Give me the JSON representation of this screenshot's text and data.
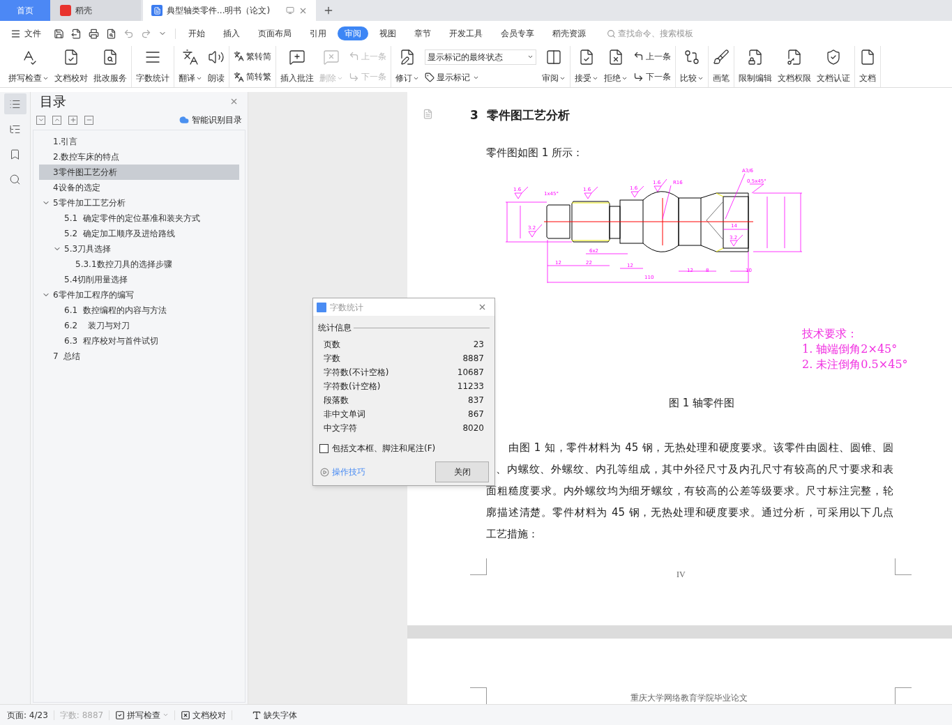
{
  "tab_bar": {
    "tabs": [
      {
        "label": "首页",
        "kind": "home",
        "selected": false
      },
      {
        "label": "稻壳",
        "kind": "docer",
        "selected": false
      },
      {
        "label": "典型轴类零件...明书（论文)",
        "kind": "document",
        "selected": true
      }
    ]
  },
  "menu": {
    "file": "文件",
    "tabs": [
      {
        "label": "开始",
        "selected": false
      },
      {
        "label": "插入",
        "selected": false
      },
      {
        "label": "页面布局",
        "selected": false
      },
      {
        "label": "引用",
        "selected": false
      },
      {
        "label": "审阅",
        "selected": true
      },
      {
        "label": "视图",
        "selected": false
      },
      {
        "label": "章节",
        "selected": false
      },
      {
        "label": "开发工具",
        "selected": false
      },
      {
        "label": "会员专享",
        "selected": false
      },
      {
        "label": "稻壳资源",
        "selected": false
      }
    ],
    "search": {
      "placeholder": "查找命令、搜索模板"
    }
  },
  "ribbon": {
    "groups": [
      {
        "items": [
          {
            "kind": "big",
            "label": "拼写检查",
            "dropdown": true,
            "disabled": false
          },
          {
            "kind": "big",
            "label": "文档校对",
            "dropdown": false,
            "disabled": false
          },
          {
            "kind": "big",
            "label": "批改服务",
            "dropdown": false,
            "disabled": false
          }
        ]
      },
      {
        "items": [
          {
            "kind": "big",
            "label": "字数统计",
            "dropdown": false,
            "disabled": false
          }
        ]
      },
      {
        "items": [
          {
            "kind": "big",
            "label": "翻译",
            "dropdown": true,
            "disabled": false
          },
          {
            "kind": "big",
            "label": "朗读",
            "dropdown": false,
            "disabled": false
          }
        ]
      },
      {
        "items": [
          {
            "kind": "pair",
            "rows": [
              {
                "label": "繁转简",
                "disabled": false
              },
              {
                "label": "简转繁",
                "disabled": false
              }
            ]
          }
        ]
      },
      {
        "items": [
          {
            "kind": "big",
            "label": "插入批注",
            "dropdown": false,
            "disabled": false
          },
          {
            "kind": "big",
            "label": "删除",
            "dropdown": true,
            "disabled": true
          },
          {
            "kind": "pair",
            "rows": [
              {
                "label": "上一条",
                "disabled": true
              },
              {
                "label": "下一条",
                "disabled": true
              }
            ]
          }
        ]
      },
      {
        "items": [
          {
            "kind": "big",
            "label": "修订",
            "dropdown": true,
            "disabled": false
          },
          {
            "kind": "select",
            "value": "显示标记的最终状态",
            "row": {
              "label": "显示标记",
              "dropdown": true
            }
          },
          {
            "kind": "big",
            "label": "审阅",
            "dropdown": true,
            "disabled": false
          }
        ]
      },
      {
        "items": [
          {
            "kind": "big",
            "label": "接受",
            "dropdown": true,
            "disabled": false
          },
          {
            "kind": "big",
            "label": "拒绝",
            "dropdown": true,
            "disabled": false
          },
          {
            "kind": "pair",
            "rows": [
              {
                "label": "上一条",
                "disabled": false
              },
              {
                "label": "下一条",
                "disabled": false
              }
            ]
          }
        ]
      },
      {
        "items": [
          {
            "kind": "big",
            "label": "比较",
            "dropdown": true,
            "disabled": false
          }
        ]
      },
      {
        "items": [
          {
            "kind": "big",
            "label": "画笔",
            "dropdown": false,
            "disabled": false
          }
        ]
      },
      {
        "items": [
          {
            "kind": "big",
            "label": "限制编辑",
            "dropdown": false,
            "disabled": false
          },
          {
            "kind": "big",
            "label": "文档权限",
            "dropdown": false,
            "disabled": false
          },
          {
            "kind": "big",
            "label": "文档认证",
            "dropdown": false,
            "disabled": false
          }
        ]
      },
      {
        "items": [
          {
            "kind": "big",
            "label": "文档",
            "dropdown": false,
            "disabled": false
          }
        ]
      }
    ]
  },
  "left_rail": [
    {
      "selected": true
    },
    {
      "selected": false
    },
    {
      "selected": false
    },
    {
      "selected": false
    }
  ],
  "toc": {
    "title": "目录",
    "smart_button": "智能识别目录",
    "items": [
      {
        "label": "1.引言",
        "selected": false
      },
      {
        "label": "2.数控车床的特点",
        "selected": false
      },
      {
        "label": "3零件图工艺分析",
        "selected": true
      },
      {
        "label": "4设备的选定",
        "selected": false
      },
      {
        "label": "5零件加工工艺分析",
        "selected": false,
        "expanded": true,
        "children": [
          {
            "label": "5.1  确定零件的定位基准和装夹方式",
            "selected": false
          },
          {
            "label": "5.2  确定加工顺序及进给路线",
            "selected": false
          },
          {
            "label": "5.3刀具选择",
            "selected": false,
            "expanded": true,
            "children": [
              {
                "label": "5.3.1数控刀具的选择步骤",
                "selected": false
              }
            ]
          },
          {
            "label": "5.4切削用量选择",
            "selected": false
          }
        ]
      },
      {
        "label": "6零件加工程序的编写",
        "selected": false,
        "expanded": true,
        "children": [
          {
            "label": "6.1  数控编程的内容与方法",
            "selected": false
          },
          {
            "label": "6.2    装刀与对刀",
            "selected": false
          },
          {
            "label": "6.3  程序校对与首件试切",
            "selected": false
          }
        ]
      },
      {
        "label": "7  总结",
        "selected": false
      }
    ]
  },
  "document": {
    "heading": {
      "number": "3",
      "title": "零件图工艺分析"
    },
    "intro": "零件图如图 1 所示：",
    "drawing": {
      "labels": [
        "1.6",
        "1x45°",
        "1.6",
        "1.6",
        "1.6",
        "R16",
        "A3/6",
        "0.5x45°",
        "3.2",
        "3.2",
        "6x2",
        "14",
        "12",
        "22",
        "12",
        "12",
        "8",
        "10",
        "110"
      ]
    },
    "requirements": [
      "技术要求：",
      "1. 轴端倒角2×45°",
      "2. 未注倒角0.5×45°"
    ],
    "caption": "图 1  轴零件图",
    "paragraph_lines": [
      "由图 1 知，零件材料为 45 钢，无热处理和硬度要求。该零件由圆柱、圆锥、圆",
      "、内螺纹、外螺纹、内孔等组成，其中外径尺寸及内孔尺寸有较高的尺寸要求和表",
      "面粗糙度要求。内外螺纹均为细牙螺纹，有较高的公差等级要求。尺寸标注完整，轮",
      "廓描述清楚。零件材料为 45 钢，无热处理和硬度要求。通过分析，可采用以下几点",
      "工艺措施："
    ],
    "page_number": "IV",
    "next_page_header": "重庆大学网络教育学院毕业论文"
  },
  "dialog": {
    "title": "字数统计",
    "group": "统计信息",
    "rows": [
      {
        "label": "页数",
        "value": "23"
      },
      {
        "label": "字数",
        "value": "8887"
      },
      {
        "label": "字符数(不计空格)",
        "value": "10687"
      },
      {
        "label": "字符数(计空格)",
        "value": "11233"
      },
      {
        "label": "段落数",
        "value": "837"
      },
      {
        "label": "非中文单词",
        "value": "867"
      },
      {
        "label": "中文字符",
        "value": "8020"
      }
    ],
    "checkbox": {
      "label": "包括文本框、脚注和尾注(F)",
      "checked": false
    },
    "link": "操作技巧",
    "button": "关闭"
  },
  "status_bar": {
    "page": "页面: 4/23",
    "words": "字数: 8887",
    "spell": "拼写检查",
    "proof": "文档校对",
    "fonts": "缺失字体"
  }
}
